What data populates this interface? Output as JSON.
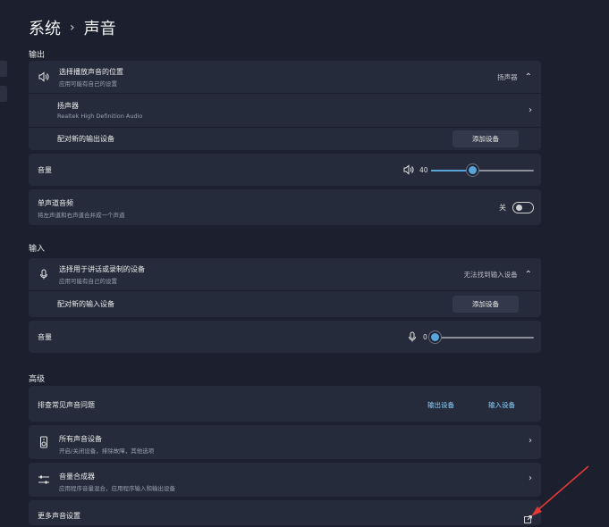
{
  "breadcrumb": {
    "parent": "系统",
    "separator": "›",
    "current": "声音"
  },
  "output": {
    "section_label": "输出",
    "choose_device": {
      "title": "选择播放声音的位置",
      "subtitle": "应用可能有自己的设置",
      "value": "扬声器"
    },
    "speaker": {
      "title": "扬声器",
      "subtitle": "Realtek High Definition Audio"
    },
    "pair": {
      "label": "配对新的输出设备",
      "button": "添加设备"
    },
    "volume": {
      "label": "音量",
      "value": "40",
      "level_percent": 40
    },
    "mono": {
      "title": "单声道音频",
      "subtitle": "将左声道和右声道合并成一个声道",
      "state": "关"
    }
  },
  "input": {
    "section_label": "输入",
    "choose_device": {
      "title": "选择用于讲话或录制的设备",
      "subtitle": "应用可能有自己的设置",
      "value": "无法找到输入设备"
    },
    "pair": {
      "label": "配对新的输入设备",
      "button": "添加设备"
    },
    "volume": {
      "label": "音量",
      "value": "0",
      "level_percent": 0
    }
  },
  "advanced": {
    "section_label": "高级",
    "troubleshoot": {
      "label": "排查常见声音问题",
      "output_link": "输出设备",
      "input_link": "输入设备"
    },
    "all_devices": {
      "title": "所有声音设备",
      "subtitle": "开启/关闭设备，排除故障，其他选项"
    },
    "mixer": {
      "title": "音量合成器",
      "subtitle": "应用程序音量混合，应用程序输入和输出设备"
    },
    "more": {
      "label": "更多声音设置"
    }
  },
  "annotation": {
    "arrow_color": "#e53935"
  }
}
